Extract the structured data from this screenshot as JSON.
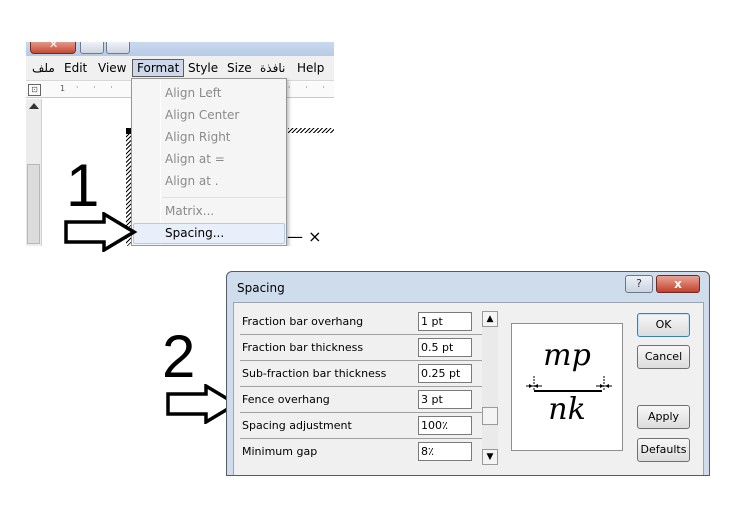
{
  "step1": {
    "number": "1",
    "menubar": [
      "ملف",
      "Edit",
      "View",
      "Format",
      "Style",
      "Size",
      "نافذة",
      "Help"
    ],
    "ruler_mark": "1",
    "format_menu": [
      {
        "label": "Align Left",
        "enabled": false
      },
      {
        "label": "Align Center",
        "enabled": false
      },
      {
        "label": "Align Right",
        "enabled": false
      },
      {
        "label": "Align at =",
        "enabled": false
      },
      {
        "label": "Align at .",
        "enabled": false
      },
      {
        "label": "Matrix...",
        "enabled": false
      },
      {
        "label": "Spacing...",
        "enabled": true
      }
    ],
    "trailing_text": "— ×"
  },
  "step2": {
    "number": "2",
    "dialog": {
      "title": "Spacing",
      "help_label": "?",
      "close_label": "x",
      "properties": [
        {
          "label": "Fraction bar overhang",
          "value": "1 pt"
        },
        {
          "label": "Fraction bar thickness",
          "value": "0.5 pt"
        },
        {
          "label": "Sub-fraction bar thickness",
          "value": "0.25 pt"
        },
        {
          "label": "Fence overhang",
          "value": "3 pt"
        },
        {
          "label": "Spacing adjustment",
          "value": "100٪"
        },
        {
          "label": "Minimum gap",
          "value": "8٪"
        }
      ],
      "preview": {
        "numerator": "mp",
        "denominator": "nk"
      },
      "buttons": {
        "ok": "OK",
        "cancel": "Cancel",
        "apply": "Apply",
        "defaults": "Defaults"
      }
    }
  },
  "icons": {
    "arrow": "right-arrow-icon"
  }
}
